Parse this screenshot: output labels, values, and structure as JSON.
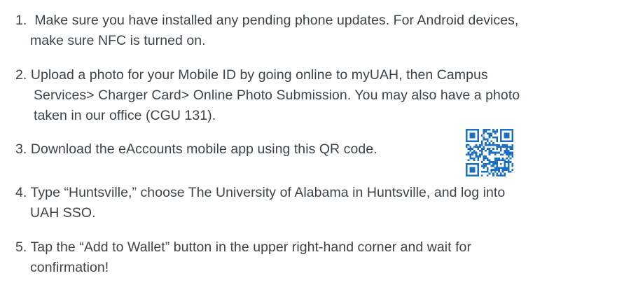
{
  "steps": [
    {
      "number": "1.",
      "lines": [
        "Make sure you have installed any pending phone updates. For Android devices,",
        "make sure NFC is turned on."
      ]
    },
    {
      "number": "2.",
      "lines": [
        "Upload a photo for your Mobile ID by going online to myUAH, then Campus",
        "Services> Charger Card> Online Photo Submission. You may also have a photo",
        "taken in our office (CGU 131)."
      ]
    },
    {
      "number": "3.",
      "lines": [
        "Download the eAccounts mobile app using this QR code."
      ],
      "image": "qr-code"
    },
    {
      "number": "4.",
      "lines": [
        "Type “Huntsville,” choose The University of Alabama in Huntsville, and log into",
        "UAH SSO."
      ]
    },
    {
      "number": "5.",
      "lines": [
        "Tap the “Add to Wallet” button in the upper right-hand corner and wait for",
        "confirmation!"
      ]
    }
  ],
  "colors": {
    "text": "#3c4349",
    "qr": "#1b6fc4"
  }
}
